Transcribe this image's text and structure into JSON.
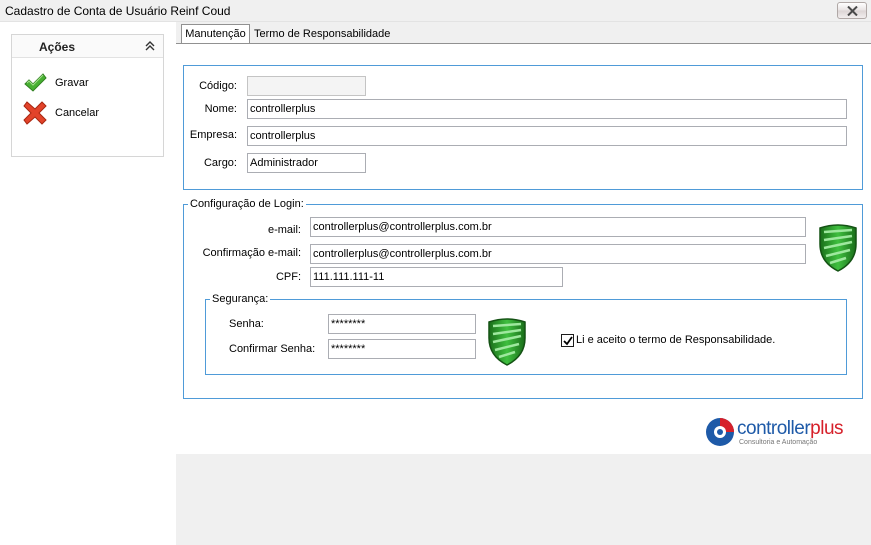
{
  "window": {
    "title": "Cadastro de Conta de Usuário Reinf Coud"
  },
  "actions": {
    "header": "Ações",
    "items": [
      {
        "label": "Gravar",
        "icon": "checkmark-icon"
      },
      {
        "label": "Cancelar",
        "icon": "cross-icon"
      }
    ]
  },
  "tabs": [
    {
      "label": "Manutenção",
      "active": true
    },
    {
      "label": "Termo de Responsabilidade",
      "active": false
    }
  ],
  "form": {
    "codigo_label": "Código:",
    "codigo_value": "",
    "nome_label": "Nome:",
    "nome_value": "controllerplus",
    "empresa_label": "Empresa:",
    "empresa_value": "controllerplus",
    "cargo_label": "Cargo:",
    "cargo_value": "Administrador"
  },
  "login": {
    "legend": "Configuração de Login:",
    "email_label": "e-mail:",
    "email_value": "controllerplus@controllerplus.com.br",
    "confirm_email_label": "Confirmação e-mail:",
    "confirm_email_value": "controllerplus@controllerplus.com.br",
    "cpf_label": "CPF:",
    "cpf_value": "111.111.111-11"
  },
  "security": {
    "legend": "Segurança:",
    "senha_label": "Senha:",
    "senha_value": "********",
    "confirm_senha_label": "Confirmar Senha:",
    "confirm_senha_value": "********",
    "terms_label": "Li e aceito o termo de Responsabilidade.",
    "terms_checked": true
  },
  "logo": {
    "brand_controller": "controller",
    "brand_plus": "plus",
    "tagline": "Consultoria e Automação",
    "color_controller": "#1e5aa8",
    "color_plus": "#d6202a"
  },
  "colors": {
    "group_border": "#4f9bd8",
    "shield_green": "#2f9e2f"
  }
}
